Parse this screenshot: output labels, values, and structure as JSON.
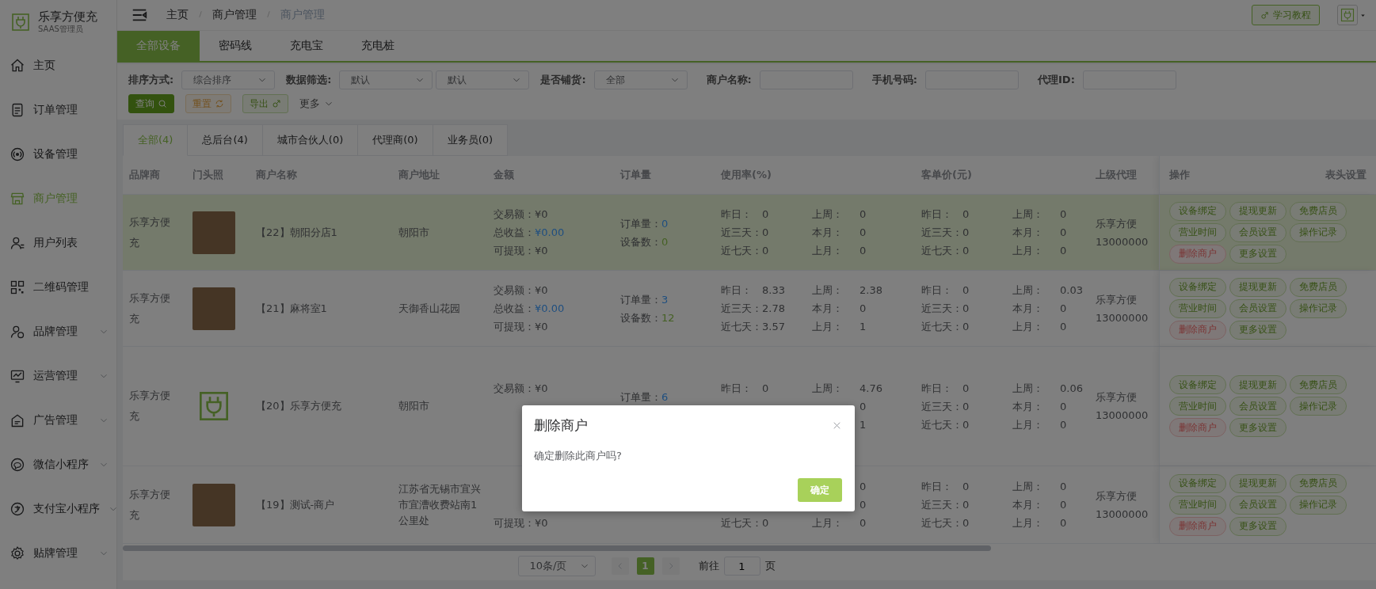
{
  "brand": {
    "name": "乐享方便充",
    "subtitle": "SAAS管理员"
  },
  "sidebar": {
    "items": [
      {
        "label": "主页",
        "selected": false,
        "expandable": false
      },
      {
        "label": "订单管理",
        "selected": false,
        "expandable": false
      },
      {
        "label": "设备管理",
        "selected": false,
        "expandable": false
      },
      {
        "label": "商户管理",
        "selected": true,
        "expandable": false
      },
      {
        "label": "用户列表",
        "selected": false,
        "expandable": false
      },
      {
        "label": "二维码管理",
        "selected": false,
        "expandable": false
      },
      {
        "label": "品牌管理",
        "selected": false,
        "expandable": true
      },
      {
        "label": "运营管理",
        "selected": false,
        "expandable": true
      },
      {
        "label": "广告管理",
        "selected": false,
        "expandable": true
      },
      {
        "label": "微信小程序",
        "selected": false,
        "expandable": true
      },
      {
        "label": "支付宝小程序",
        "selected": false,
        "expandable": true
      },
      {
        "label": "贴牌管理",
        "selected": false,
        "expandable": true
      }
    ]
  },
  "breadcrumb": [
    {
      "label": "主页",
      "selected": false
    },
    {
      "label": "商户管理",
      "selected": false
    },
    {
      "label": "商户管理",
      "selected": true
    }
  ],
  "tutorial_button": "学习教程",
  "device_tabs": [
    {
      "label": "全部设备",
      "selected": true
    },
    {
      "label": "密码线",
      "selected": false
    },
    {
      "label": "充电宝",
      "selected": false
    },
    {
      "label": "充电桩",
      "selected": false
    }
  ],
  "filters": {
    "selects": [
      {
        "label": "排序方式:",
        "values": [
          "综合排序"
        ]
      },
      {
        "label": "数据筛选:",
        "values": [
          "默认",
          "默认"
        ]
      },
      {
        "label": "是否铺货:",
        "values": [
          "全部"
        ]
      }
    ],
    "text_fields": [
      {
        "label": "商户名称:"
      },
      {
        "label": "手机号码:"
      },
      {
        "label": "代理ID:"
      }
    ],
    "actions": [
      {
        "label": "查询",
        "kind": "query"
      },
      {
        "label": "重置",
        "kind": "reset"
      },
      {
        "label": "导出",
        "kind": "export"
      }
    ],
    "more": "更多"
  },
  "role_tabs": [
    {
      "label": "全部(4)",
      "selected": true
    },
    {
      "label": "总后台(4)",
      "selected": false
    },
    {
      "label": "城市合伙人(0)",
      "selected": false
    },
    {
      "label": "代理商(0)",
      "selected": false
    },
    {
      "label": "业务员(0)",
      "selected": false
    }
  ],
  "table": {
    "columns": [
      "品牌商",
      "门头照",
      "商户名称",
      "商户地址",
      "金额",
      "订单量",
      "使用率(%)",
      "客单价(元)",
      "上级代理"
    ],
    "action_column": {
      "title": "操作",
      "settings": "表头设置"
    },
    "rows": [
      {
        "highlighted": true,
        "brand": "乐享方便充",
        "kind": "photo",
        "name": "【22】朝阳分店1",
        "address": "朝阳市",
        "amount": [
          {
            "kind": "plain",
            "label": "交易额：",
            "value": "¥0"
          },
          {
            "kind": "link",
            "label": "总收益：",
            "value": "¥0.00"
          },
          {
            "kind": "plain",
            "label": "可提现：",
            "value": "¥0"
          }
        ],
        "orders": [
          {
            "kind": "link",
            "label": "订单量：",
            "value": "0"
          },
          {
            "kind": "count",
            "label": "设备数：",
            "value": "0"
          }
        ],
        "usage": [
          [
            {
              "kind": "plain",
              "label": "昨日：",
              "value": "0"
            },
            {
              "kind": "plain",
              "label": "近三天：",
              "value": "0"
            },
            {
              "kind": "plain",
              "label": "近七天：",
              "value": "0"
            }
          ],
          [
            {
              "kind": "plain",
              "label": "上周：",
              "value": "0"
            },
            {
              "kind": "plain",
              "label": "本月：",
              "value": "0"
            },
            {
              "kind": "plain",
              "label": "上月：",
              "value": "0"
            }
          ]
        ],
        "price": [
          [
            {
              "kind": "plain",
              "label": "昨日：",
              "value": "0"
            },
            {
              "kind": "plain",
              "label": "近三天：",
              "value": "0"
            },
            {
              "kind": "plain",
              "label": "近七天：",
              "value": "0"
            }
          ],
          [
            {
              "kind": "plain",
              "label": "上周：",
              "value": "0"
            },
            {
              "kind": "plain",
              "label": "本月：",
              "value": "0"
            },
            {
              "kind": "plain",
              "label": "上月：",
              "value": "0"
            }
          ]
        ],
        "agent": [
          "乐享方便",
          "13000000"
        ],
        "actions": [
          {
            "label": "设备绑定",
            "kind": "normal"
          },
          {
            "label": "提现更新",
            "kind": "normal"
          },
          {
            "label": "免费店员",
            "kind": "normal"
          },
          {
            "label": "营业时间",
            "kind": "normal"
          },
          {
            "label": "会员设置",
            "kind": "normal"
          },
          {
            "label": "操作记录",
            "kind": "normal"
          },
          {
            "label": "删除商户",
            "kind": "danger"
          },
          {
            "label": "更多设置",
            "kind": "normal"
          }
        ]
      },
      {
        "highlighted": false,
        "brand": "乐享方便充",
        "kind": "photo",
        "name": "【21】麻将室1",
        "address": "天御香山花园",
        "amount": [
          {
            "kind": "plain",
            "label": "交易额：",
            "value": "¥0"
          },
          {
            "kind": "link",
            "label": "总收益：",
            "value": "¥0.00"
          },
          {
            "kind": "plain",
            "label": "可提现：",
            "value": "¥0"
          }
        ],
        "orders": [
          {
            "kind": "link",
            "label": "订单量：",
            "value": "3"
          },
          {
            "kind": "count",
            "label": "设备数：",
            "value": "12"
          }
        ],
        "usage": [
          [
            {
              "kind": "plain",
              "label": "昨日：",
              "value": "8.33"
            },
            {
              "kind": "plain",
              "label": "近三天：",
              "value": "2.78"
            },
            {
              "kind": "plain",
              "label": "近七天：",
              "value": "3.57"
            }
          ],
          [
            {
              "kind": "plain",
              "label": "上周：",
              "value": "2.38"
            },
            {
              "kind": "plain",
              "label": "本月：",
              "value": "0"
            },
            {
              "kind": "plain",
              "label": "上月：",
              "value": "1"
            }
          ]
        ],
        "price": [
          [
            {
              "kind": "plain",
              "label": "昨日：",
              "value": "0"
            },
            {
              "kind": "plain",
              "label": "近三天：",
              "value": "0"
            },
            {
              "kind": "plain",
              "label": "近七天：",
              "value": "0"
            }
          ],
          [
            {
              "kind": "plain",
              "label": "上周：",
              "value": "0.03"
            },
            {
              "kind": "plain",
              "label": "本月：",
              "value": "0"
            },
            {
              "kind": "plain",
              "label": "上月：",
              "value": "0"
            }
          ]
        ],
        "agent": [
          "乐享方便",
          "13000000"
        ],
        "actions": [
          {
            "label": "设备绑定",
            "kind": "normal"
          },
          {
            "label": "提现更新",
            "kind": "normal"
          },
          {
            "label": "免费店员",
            "kind": "normal"
          },
          {
            "label": "营业时间",
            "kind": "normal"
          },
          {
            "label": "会员设置",
            "kind": "normal"
          },
          {
            "label": "操作记录",
            "kind": "normal"
          },
          {
            "label": "删除商户",
            "kind": "danger"
          },
          {
            "label": "更多设置",
            "kind": "normal"
          }
        ]
      },
      {
        "highlighted": false,
        "brand": "乐享方便充",
        "kind": "logo",
        "name": "【20】乐享方便充",
        "address": "朝阳市",
        "amount": [
          {
            "kind": "plain",
            "label": "交易额：",
            "value": "¥0"
          },
          {
            "kind": "gap"
          },
          {
            "kind": "gap"
          }
        ],
        "orders": [
          {
            "kind": "link",
            "label": "订单量：",
            "value": "6"
          },
          {
            "kind": "gap"
          }
        ],
        "usage": [
          [
            {
              "kind": "plain",
              "label": "昨日：",
              "value": "0"
            },
            {
              "kind": "gap"
            },
            {
              "kind": "gap"
            }
          ],
          [
            {
              "kind": "plain",
              "label": "上周：",
              "value": "4.76"
            },
            {
              "kind": "plain",
              "value": "0"
            },
            {
              "kind": "plain",
              "value": "1"
            }
          ]
        ],
        "price": [
          [
            {
              "kind": "plain",
              "label": "昨日：",
              "value": "0"
            },
            {
              "kind": "plain",
              "label": "近三天：",
              "value": "0"
            },
            {
              "kind": "plain",
              "label": "近七天：",
              "value": "0"
            }
          ],
          [
            {
              "kind": "plain",
              "label": "上周：",
              "value": "0.06"
            },
            {
              "kind": "plain",
              "label": "本月：",
              "value": "0"
            },
            {
              "kind": "plain",
              "label": "上月：",
              "value": "0"
            }
          ]
        ],
        "agent": [
          "乐享方便",
          "13000000"
        ],
        "actions": [
          {
            "label": "设备绑定",
            "kind": "normal"
          },
          {
            "label": "提现更新",
            "kind": "normal"
          },
          {
            "label": "免费店员",
            "kind": "normal"
          },
          {
            "label": "营业时间",
            "kind": "normal"
          },
          {
            "label": "会员设置",
            "kind": "normal"
          },
          {
            "label": "操作记录",
            "kind": "normal"
          },
          {
            "label": "删除商户",
            "kind": "danger"
          },
          {
            "label": "更多设置",
            "kind": "normal"
          }
        ]
      },
      {
        "highlighted": false,
        "brand": "乐享方便充",
        "kind": "photo",
        "name": "【19】测试-商户",
        "address": "江苏省无锡市宜兴市宜漕收费站南1公里处",
        "amount": [
          {
            "kind": "gap"
          },
          {
            "kind": "gap"
          },
          {
            "kind": "plain",
            "label": "可提现：",
            "value": "¥0"
          }
        ],
        "orders": [
          {
            "kind": "gap"
          },
          {
            "kind": "gap"
          }
        ],
        "usage": [
          [
            {
              "kind": "gap"
            },
            {
              "kind": "gap"
            },
            {
              "kind": "plain",
              "label": "近七天：",
              "value": "0"
            }
          ],
          [
            {
              "kind": "plain",
              "value": "0"
            },
            {
              "kind": "plain",
              "value": "0"
            },
            {
              "kind": "plain",
              "label": "上月：",
              "value": "0"
            }
          ]
        ],
        "price": [
          [
            {
              "kind": "plain",
              "label": "昨日：",
              "value": "0"
            },
            {
              "kind": "plain",
              "label": "近三天：",
              "value": "0"
            },
            {
              "kind": "plain",
              "label": "近七天：",
              "value": "0"
            }
          ],
          [
            {
              "kind": "plain",
              "label": "上周：",
              "value": "0"
            },
            {
              "kind": "plain",
              "label": "本月：",
              "value": "0"
            },
            {
              "kind": "plain",
              "label": "上月：",
              "value": "0"
            }
          ]
        ],
        "agent": [
          "乐享方便",
          "13000000"
        ],
        "actions": [
          {
            "label": "设备绑定",
            "kind": "normal"
          },
          {
            "label": "提现更新",
            "kind": "normal"
          },
          {
            "label": "免费店员",
            "kind": "normal"
          },
          {
            "label": "营业时间",
            "kind": "normal"
          },
          {
            "label": "会员设置",
            "kind": "normal"
          },
          {
            "label": "操作记录",
            "kind": "normal"
          },
          {
            "label": "删除商户",
            "kind": "danger"
          },
          {
            "label": "更多设置",
            "kind": "normal"
          }
        ]
      }
    ]
  },
  "pagination": {
    "page_size": "10条/页",
    "pages": [
      {
        "label": "1",
        "selected": true
      }
    ],
    "goto_label": "前往",
    "goto_value": "1",
    "page_suffix": "页"
  },
  "dialog": {
    "title": "删除商户",
    "message": "确定删除此商户吗?",
    "confirm": "确定"
  }
}
